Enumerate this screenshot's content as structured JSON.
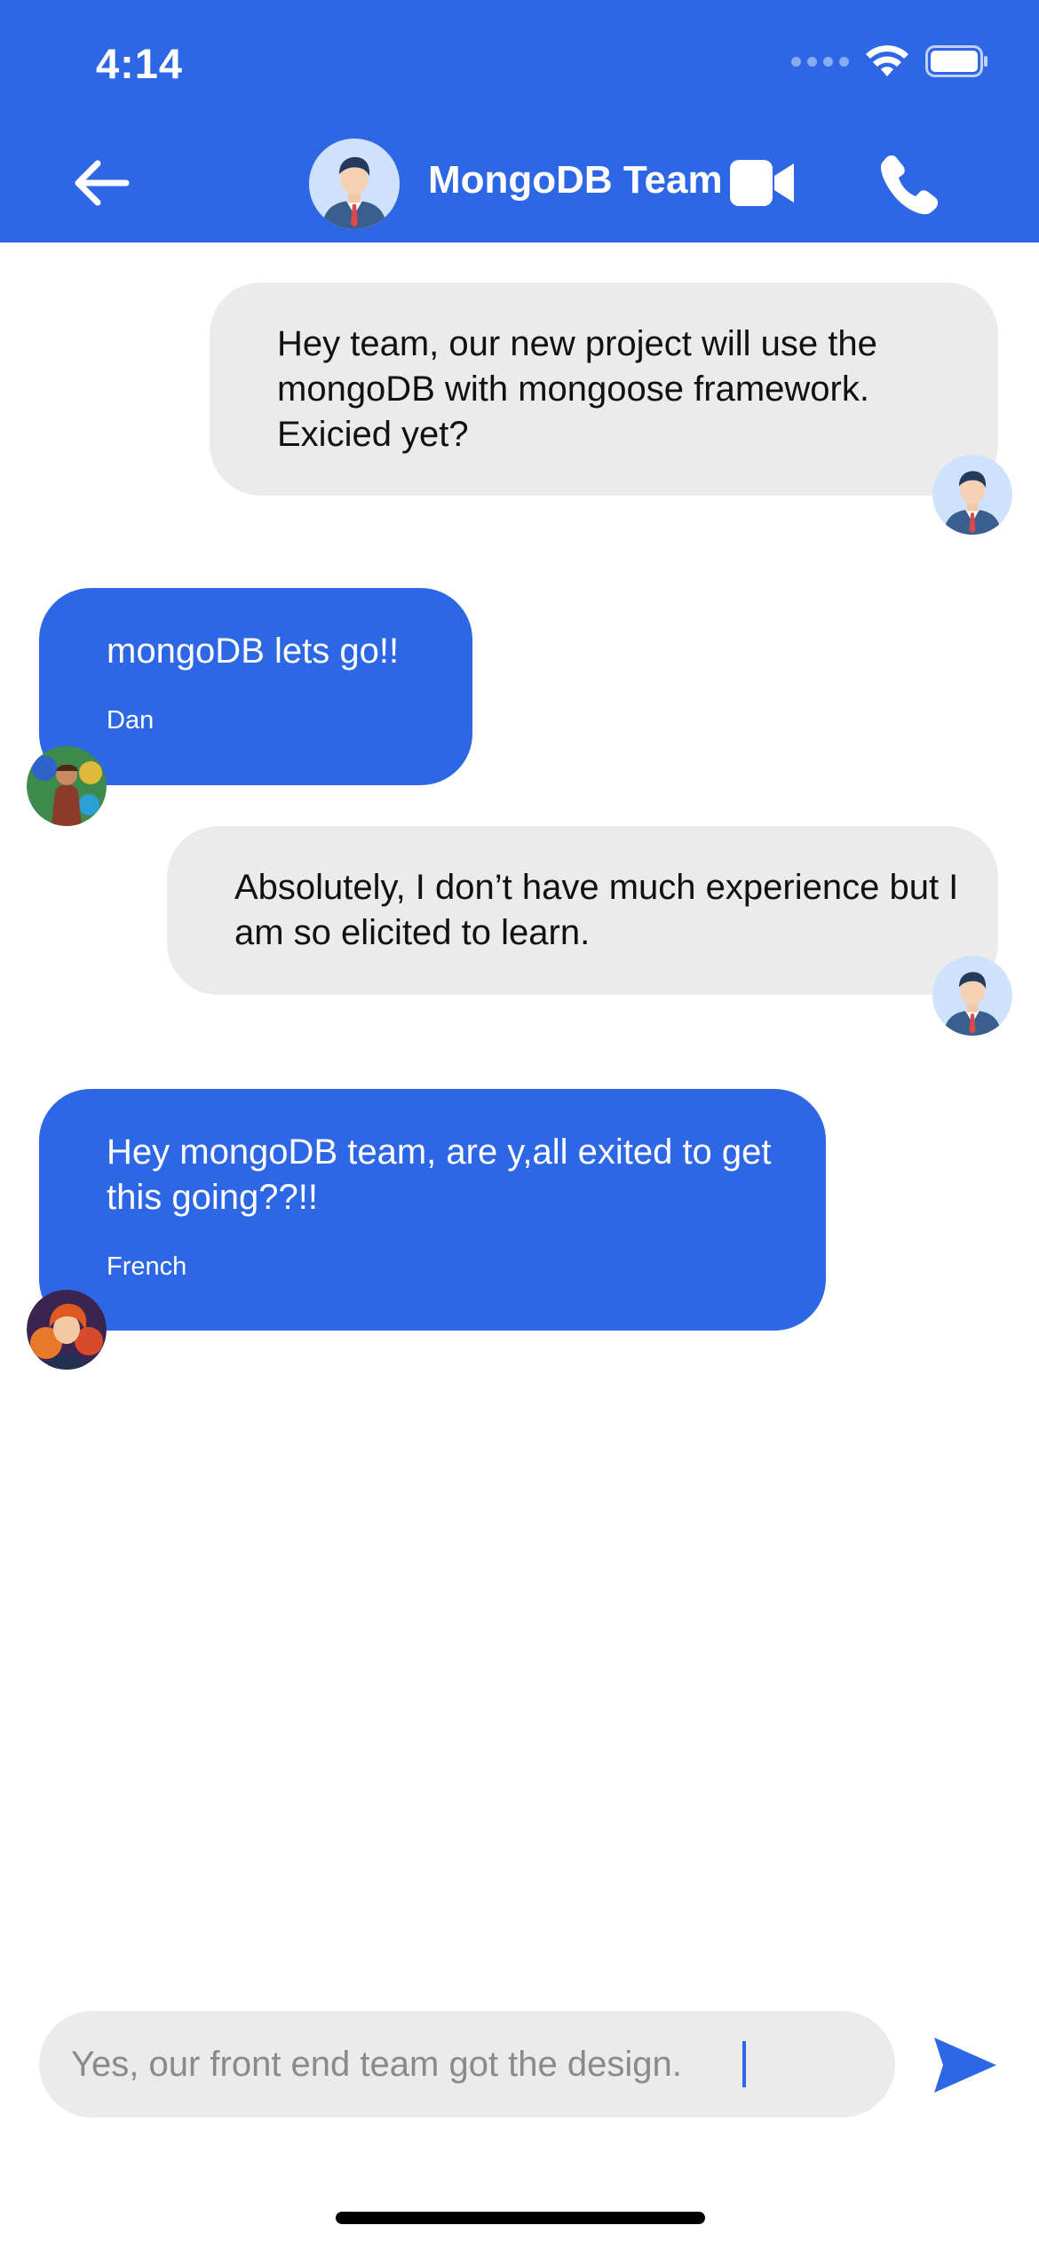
{
  "status_bar": {
    "time": "4:14"
  },
  "header": {
    "title": "MongoDB Team"
  },
  "messages": [
    {
      "direction": "out",
      "text": "Hey team, our new project will use the mongoDB with mongoose framework. Exicied yet?"
    },
    {
      "direction": "in",
      "text": "mongoDB lets go!!",
      "sender": "Dan"
    },
    {
      "direction": "out",
      "text": "Absolutely, I don’t have much experience but I am so elicited to learn."
    },
    {
      "direction": "in",
      "text": "Hey mongoDB team, are y,all exited to get this going??!!",
      "sender": "French"
    }
  ],
  "composer": {
    "value": "Yes, our front end team got the design."
  },
  "icons": {
    "back": "arrow-left-icon",
    "video": "video-camera-icon",
    "phone": "phone-icon",
    "send": "send-icon",
    "wifi": "wifi-icon",
    "battery": "battery-icon"
  },
  "colors": {
    "accent": "#2d67e6",
    "outgoing_bubble": "#ebebeb",
    "incoming_bubble": "#2d67e6"
  }
}
